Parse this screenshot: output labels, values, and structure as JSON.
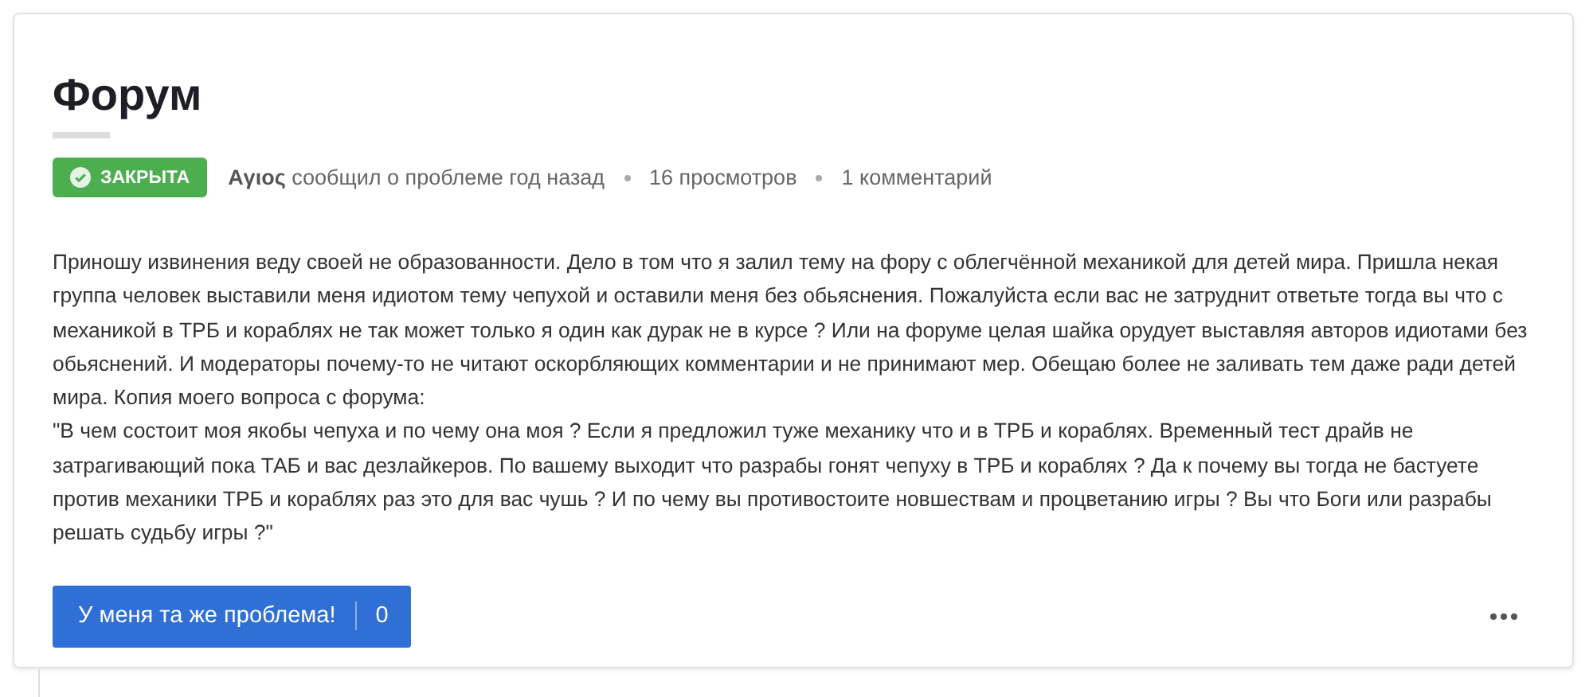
{
  "title": "Форум",
  "status": {
    "label": "ЗАКРЫТА",
    "kind": "closed"
  },
  "meta": {
    "author": "Aγιος",
    "action": "сообщил о проблеме год назад",
    "views": "16 просмотров",
    "comments": "1 комментарий"
  },
  "body": [
    "Приношу извинения веду своей не образованности. Дело в том что я залил тему на фору с облегчённой механикой для детей мира. Пришла некая группа человек выставили меня идиотом тему чепухой и оставили меня без обьяснения. Пожалуйста если вас не затруднит ответьте тогда вы что с механикой в ТРБ и кораблях не так может только я один как дурак не в курсе ? Или на форуме целая шайка орудует выставляя авторов идиотами без обьяснений. И модераторы почему-то не читают оскорбляющих комментарии и не принимают мер. Обещаю более не заливать тем даже ради детей мира. Копия моего вопроса с форума:",
    "\"В чем состоит моя якобы чепуха и по чему она моя ? Если я предложил туже механику что и в ТРБ и кораблях. Временный тест драйв не затрагивающий пока ТАБ и вас дезлайкеров. По вашему выходит что разрабы гонят чепуху в ТРБ и кораблях ? Да к почему вы тогда не бастуете против механики ТРБ и кораблях раз это для вас чушь ? И по чему вы противостоите новшествам и процветанию игры ? Вы что Боги или разрабы решать судьбу игры ?\""
  ],
  "vote_button": {
    "label": "У меня та же проблема!",
    "count": "0"
  }
}
